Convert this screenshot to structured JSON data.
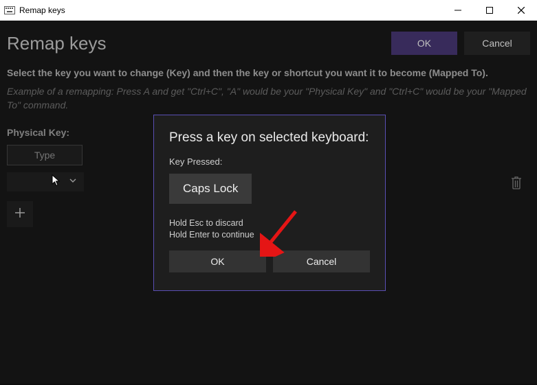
{
  "window": {
    "title": "Remap keys"
  },
  "header": {
    "page_title": "Remap keys",
    "ok_label": "OK",
    "cancel_label": "Cancel"
  },
  "instructions": {
    "main": "Select the key you want to change (Key) and then the key or shortcut you want it to become (Mapped To).",
    "example": "Example of a remapping: Press A and get \"Ctrl+C\", \"A\" would be your \"Physical Key\" and \"Ctrl+C\" would be your \"Mapped To\" command."
  },
  "labels": {
    "physical_key": "Physical Key:",
    "type_button": "Type"
  },
  "modal": {
    "title": "Press a key on selected keyboard:",
    "key_pressed_label": "Key Pressed:",
    "key_value": "Caps Lock",
    "hint_line1": "Hold Esc to discard",
    "hint_line2": "Hold Enter to continue",
    "ok_label": "OK",
    "cancel_label": "Cancel"
  }
}
